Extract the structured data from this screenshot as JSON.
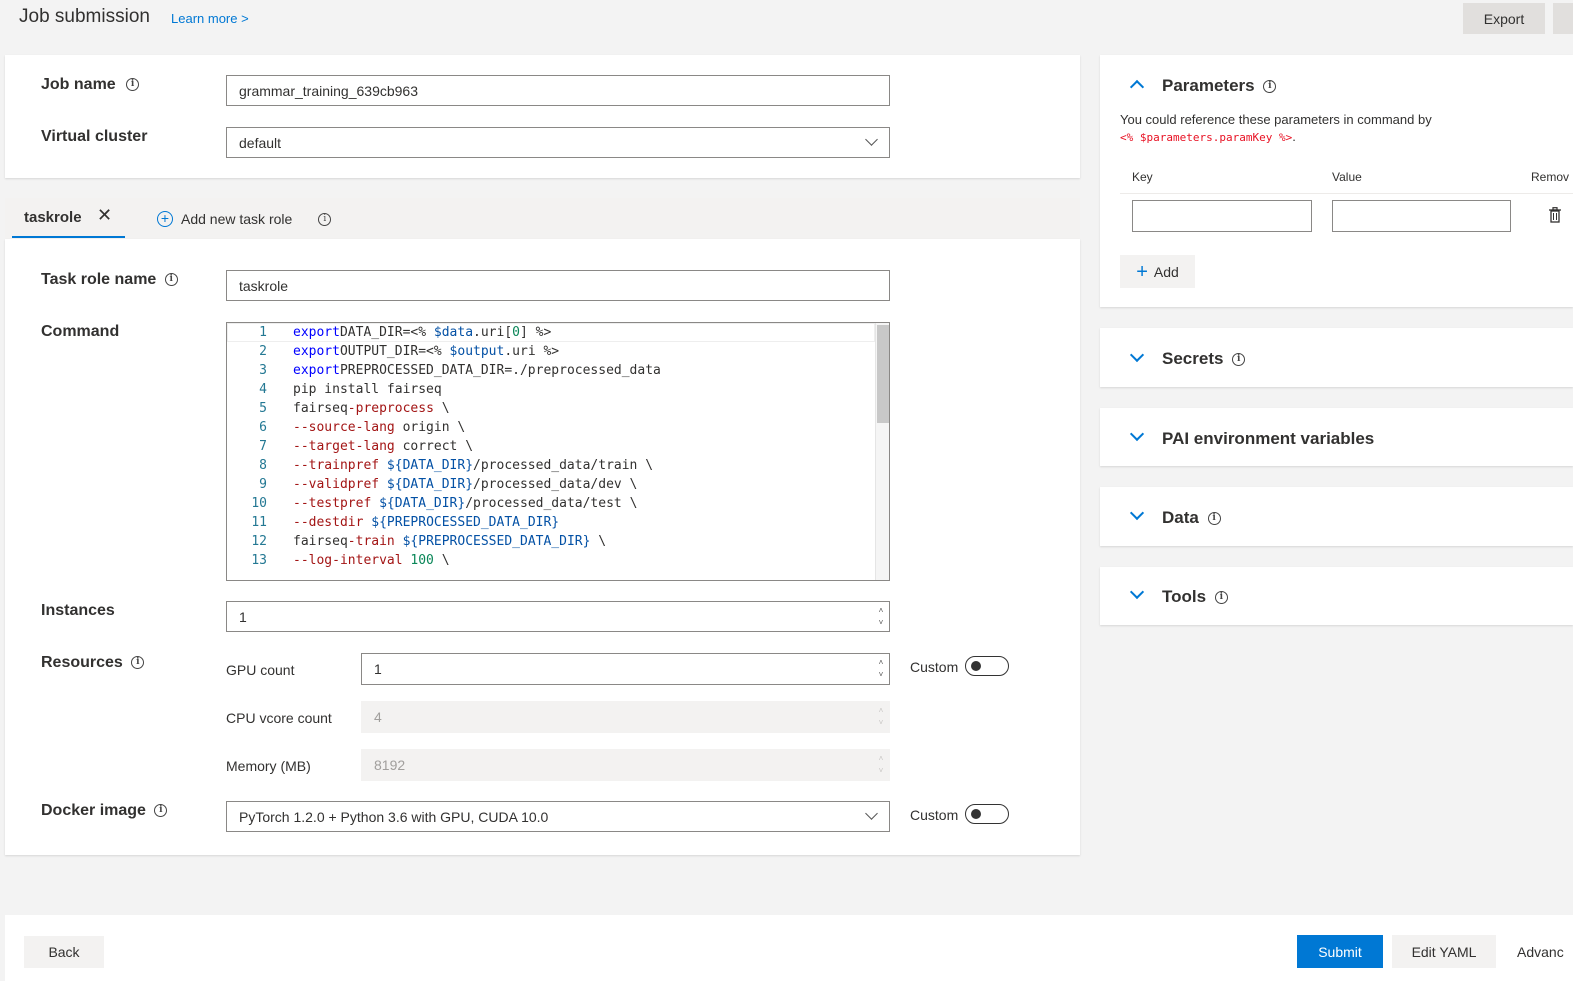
{
  "header": {
    "title": "Job submission",
    "learn_more": "Learn more >",
    "export_label": "Export"
  },
  "basic": {
    "job_name_label": "Job name",
    "job_name_value": "grammar_training_639cb963",
    "virtual_cluster_label": "Virtual cluster",
    "virtual_cluster_value": "default"
  },
  "tabs": {
    "active_tab": "taskrole",
    "add_label": "Add new task role"
  },
  "taskrole": {
    "name_label": "Task role name",
    "name_value": "taskrole",
    "command_label": "Command",
    "instances_label": "Instances",
    "instances_value": "1",
    "resources_label": "Resources",
    "gpu_label": "GPU count",
    "gpu_value": "1",
    "cpu_label": "CPU vcore count",
    "cpu_value": "4",
    "memory_label": "Memory (MB)",
    "memory_value": "8192",
    "custom_label": "Custom",
    "docker_label": "Docker image",
    "docker_value": "PyTorch 1.2.0 + Python 3.6 with GPU, CUDA 10.0",
    "docker_custom_label": "Custom"
  },
  "command_lines": [
    {
      "n": "1",
      "parts": [
        [
          "kw",
          "export"
        ],
        [
          "",
          "DATA_DIR=<% "
        ],
        [
          "str",
          "$data"
        ],
        [
          "",
          ".uri["
        ],
        [
          "num",
          "0"
        ],
        [
          "",
          "] %>"
        ]
      ]
    },
    {
      "n": "2",
      "parts": [
        [
          "kw",
          "export"
        ],
        [
          "",
          "OUTPUT_DIR=<% "
        ],
        [
          "str",
          "$output"
        ],
        [
          "",
          ".uri %>"
        ]
      ]
    },
    {
      "n": "3",
      "parts": [
        [
          "kw",
          "export"
        ],
        [
          "",
          "PREPROCESSED_DATA_DIR=./preprocessed_data"
        ]
      ]
    },
    {
      "n": "4",
      "parts": [
        [
          "",
          "pip install fairseq"
        ]
      ]
    },
    {
      "n": "5",
      "parts": [
        [
          "",
          "fairseq"
        ],
        [
          "op",
          "-preprocess"
        ],
        [
          "",
          " \\"
        ]
      ]
    },
    {
      "n": "6",
      "parts": [
        [
          "op",
          "--source-lang"
        ],
        [
          "",
          " origin \\"
        ]
      ]
    },
    {
      "n": "7",
      "parts": [
        [
          "op",
          "--target-lang"
        ],
        [
          "",
          " correct \\"
        ]
      ]
    },
    {
      "n": "8",
      "parts": [
        [
          "op",
          "--trainpref"
        ],
        [
          "",
          " "
        ],
        [
          "str",
          "${DATA_DIR}"
        ],
        [
          "",
          "/processed_data/train \\"
        ]
      ]
    },
    {
      "n": "9",
      "parts": [
        [
          "op",
          "--validpref"
        ],
        [
          "",
          " "
        ],
        [
          "str",
          "${DATA_DIR}"
        ],
        [
          "",
          "/processed_data/dev \\"
        ]
      ]
    },
    {
      "n": "10",
      "parts": [
        [
          "op",
          "--testpref"
        ],
        [
          "",
          " "
        ],
        [
          "str",
          "${DATA_DIR}"
        ],
        [
          "",
          "/processed_data/test \\"
        ]
      ]
    },
    {
      "n": "11",
      "parts": [
        [
          "op",
          "--destdir"
        ],
        [
          "",
          " "
        ],
        [
          "str",
          "${PREPROCESSED_DATA_DIR}"
        ]
      ]
    },
    {
      "n": "12",
      "parts": [
        [
          "",
          "fairseq"
        ],
        [
          "op",
          "-train"
        ],
        [
          "",
          " "
        ],
        [
          "str",
          "${PREPROCESSED_DATA_DIR}"
        ],
        [
          "",
          " \\"
        ]
      ]
    },
    {
      "n": "13",
      "parts": [
        [
          "op",
          "--log-interval"
        ],
        [
          "",
          " "
        ],
        [
          "num",
          "100"
        ],
        [
          "",
          " \\"
        ]
      ]
    }
  ],
  "parameters": {
    "title": "Parameters",
    "desc": "You could reference these parameters in command by",
    "desc_code": "<% $parameters.paramKey %>",
    "desc_end": ".",
    "key_header": "Key",
    "value_header": "Value",
    "remove_header": "Remov",
    "add_label": "Add"
  },
  "sections": {
    "secrets": "Secrets",
    "pai_env": "PAI environment variables",
    "data": "Data",
    "tools": "Tools"
  },
  "footer": {
    "back_label": "Back",
    "submit_label": "Submit",
    "edit_yaml_label": "Edit YAML",
    "advanced_label": "Advanc"
  },
  "colors": {
    "accent": "#0078d4",
    "link": "#0078d4"
  }
}
